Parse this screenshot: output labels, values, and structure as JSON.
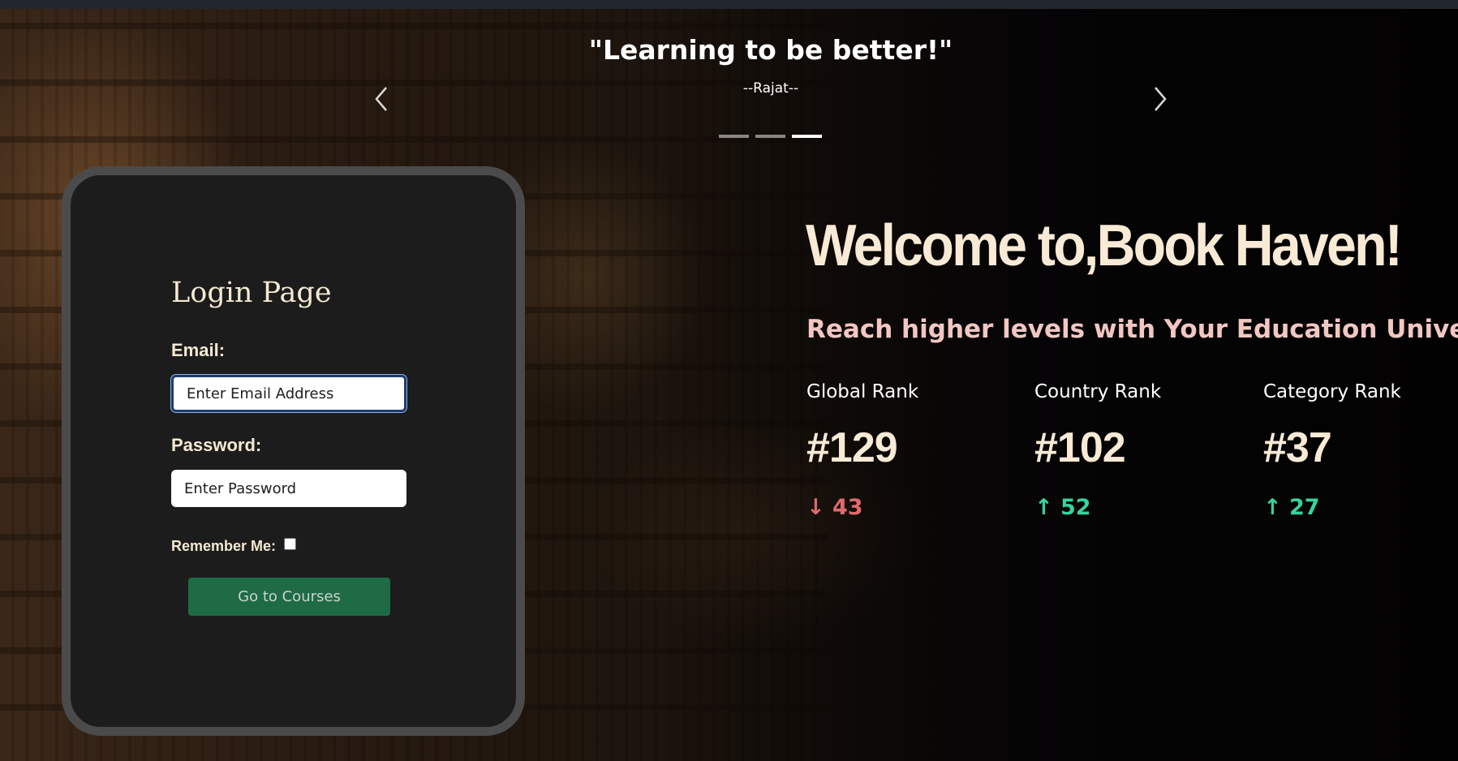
{
  "carousel": {
    "quote": "\"Learning to be better!\"",
    "author": "--Rajat--",
    "slide_count": 3,
    "active_index": 2
  },
  "login": {
    "title": "Login Page",
    "email_label": "Email:",
    "email_placeholder": "Enter Email Address",
    "password_label": "Password:",
    "password_placeholder": "Enter Password",
    "remember_label": "Remember Me:",
    "remember_checked": false,
    "submit_label": "Go to Courses"
  },
  "hero": {
    "title": "Welcome to,Book Haven!",
    "subtitle": "Reach higher levels with Your Education Universe!"
  },
  "ranks": [
    {
      "label": "Global Rank",
      "value": "#129",
      "change": "↓ 43",
      "direction": "down"
    },
    {
      "label": "Country Rank",
      "value": "#102",
      "change": "↑ 52",
      "direction": "up"
    },
    {
      "label": "Category Rank",
      "value": "#37",
      "change": "↑ 27",
      "direction": "up"
    }
  ],
  "colors": {
    "accent_cream": "#f9ead6",
    "subtitle_pink": "#f2c7c2",
    "button_green": "#1e6b45",
    "change_down": "#e06a6e",
    "change_up": "#36d39a",
    "card_background": "#1c1c1c",
    "card_border": "#4b4b4b"
  },
  "icons": {
    "prev": "chevron-left-icon",
    "next": "chevron-right-icon"
  }
}
